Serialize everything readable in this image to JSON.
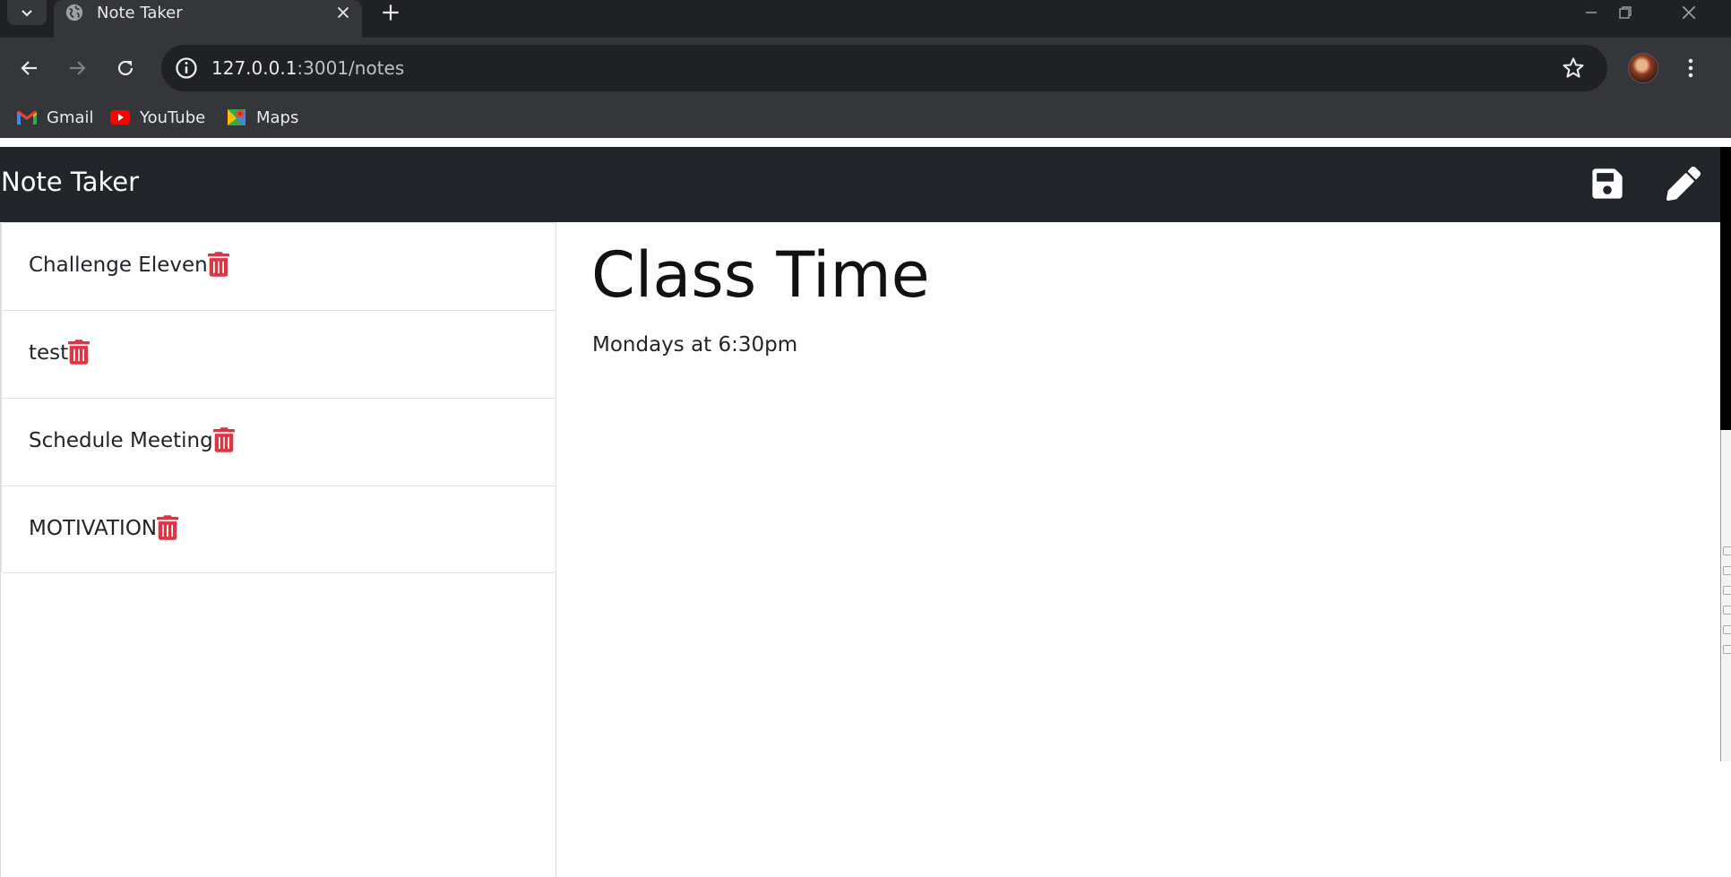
{
  "browser": {
    "tab_title": "Note Taker",
    "url_host": "127.0.0.1",
    "url_rest": ":3001/notes",
    "bookmarks": [
      {
        "label": "Gmail",
        "icon": "gmail-icon"
      },
      {
        "label": "YouTube",
        "icon": "youtube-icon"
      },
      {
        "label": "Maps",
        "icon": "maps-icon"
      }
    ]
  },
  "app": {
    "brand": "Note Taker",
    "actions": [
      {
        "name": "save-note",
        "icon": "floppy-disk-icon"
      },
      {
        "name": "new-note",
        "icon": "pencil-icon"
      }
    ],
    "notes": [
      {
        "title": "Challenge Eleven"
      },
      {
        "title": "test"
      },
      {
        "title": "Schedule Meeting"
      },
      {
        "title": "MOTIVATION"
      }
    ],
    "active_note": {
      "title": "Class Time",
      "text": "Mondays at 6:30pm"
    }
  },
  "colors": {
    "navbar": "#212529",
    "delete": "#dc3545",
    "chrome_dark": "#202124",
    "chrome_toolbar": "#35363a"
  }
}
